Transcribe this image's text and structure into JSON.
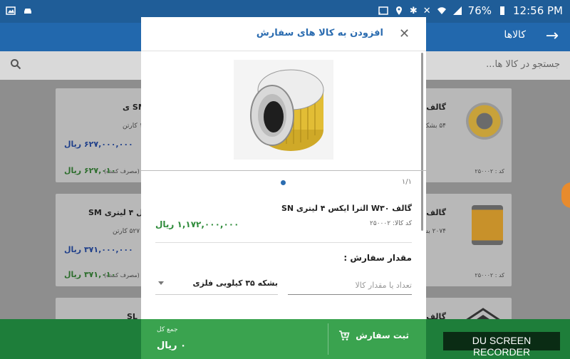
{
  "status": {
    "battery": "76%",
    "time": "12:56 PM",
    "icons": [
      "image-icon",
      "car-icon",
      "cast-icon",
      "location-icon",
      "bluetooth-icon",
      "mute-icon",
      "wifi-icon",
      "signal-icon",
      "battery-icon"
    ]
  },
  "appbar": {
    "title": "کالاها",
    "back_icon": "arrow-right-icon"
  },
  "search": {
    "placeholder": "جستجو در کالا ها..."
  },
  "list": {
    "cards": [
      {
        "title": "گالف W۳۰",
        "title_left": "SM ی",
        "sub": "۵۴ بشکه ۲۰",
        "sub_left": "۱ کارتن",
        "price": "۶۲۷,۰۰۰,۰۰۰ ریال",
        "price2": "۶۲۷,۰۱۰ ریال",
        "price2_note": "(مصرف کننده)",
        "code": "کد : ۲۵۰۰۰۲"
      },
      {
        "title": "گالف W۴۰",
        "title_left": "ستیال ۴ لیتری SM",
        "sub": "۲۰۷۴ بشکه",
        "sub_left": "۵۲۷ کارتن",
        "price": "۳۷۱,۰۰۰,۰۰۰ ریال",
        "price2": "۳۷۱,۰۱۰ ریال",
        "price2_note": "(مصرف کننده)",
        "code": "کد : ۲۵۰۰۰۲"
      },
      {
        "title": "گالف W۴۰",
        "title_left": "SL",
        "sub": "",
        "sub_left": "",
        "price": "",
        "price2": "",
        "price2_note": "",
        "code": ""
      }
    ]
  },
  "dialog": {
    "title": "افزودن به کالا های سفارش",
    "close_icon": "close-icon",
    "pager": "۱/۱",
    "product_name": "گالف W۳۰ الترا ایکس ۴ لیتری SN",
    "product_code": "کد کالا: ۲۵۰۰۰۲",
    "product_price": "۱,۱۷۲,۰۰۰,۰۰۰ ریال",
    "quantity_label": "مقدار سفارش :",
    "quantity_placeholder": "تعداد یا مقدار کالا",
    "quantity_value": "",
    "unit_selected": "بشکه ۳۵ کیلویی فلزی"
  },
  "footer": {
    "total_label": "جمع کل",
    "total_value": "۰ ریال",
    "submit_label": "ثبت سفارش",
    "submit_icon": "cart-icon"
  },
  "watermark": "DU SCREEN RECORDER",
  "colors": {
    "primary": "#2268ad",
    "accent_green": "#3aa34f",
    "price_green": "#2e8b3a",
    "title_blue": "#2b6cb0"
  }
}
